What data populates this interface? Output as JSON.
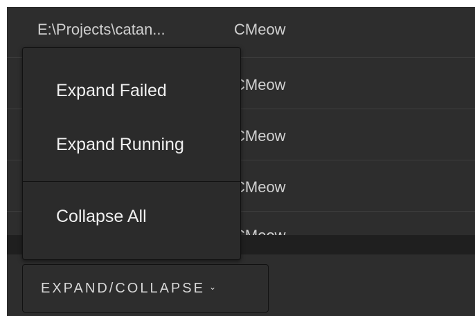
{
  "table": {
    "rows": [
      {
        "path": "E:\\Projects\\catan...",
        "user": "CMeow"
      },
      {
        "path": "",
        "user": "CMeow"
      },
      {
        "path": "",
        "user": "CMeow"
      },
      {
        "path": "",
        "user": "CMeow"
      },
      {
        "path": "",
        "user": "CMeow"
      }
    ]
  },
  "menu": {
    "items": [
      {
        "label": "Expand Failed"
      },
      {
        "label": "Expand Running"
      },
      {
        "label": "Collapse All"
      }
    ]
  },
  "button": {
    "label": "EXPAND/COLLAPSE",
    "chevron": "⌄"
  }
}
